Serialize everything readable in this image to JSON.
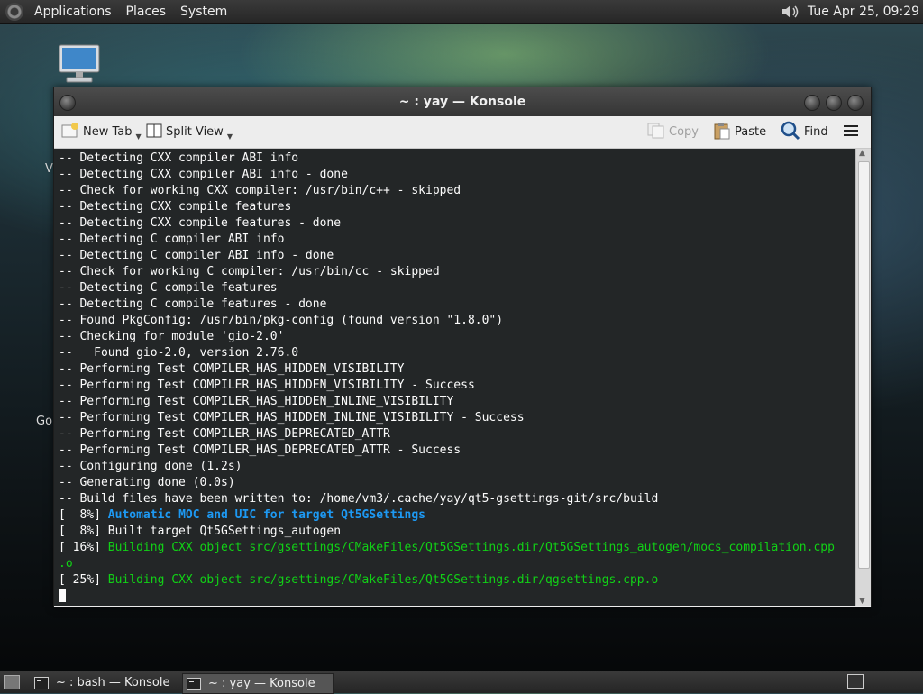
{
  "top_panel": {
    "menus": [
      "Applications",
      "Places",
      "System"
    ],
    "clock": "Tue Apr 25, 09:29"
  },
  "desktop": {
    "labels": [
      "Vi",
      "Go"
    ]
  },
  "window": {
    "title": "~ : yay — Konsole"
  },
  "toolbar": {
    "new_tab": "New Tab",
    "split_view": "Split View",
    "copy": "Copy",
    "paste": "Paste",
    "find": "Find"
  },
  "terminal": {
    "lines": [
      {
        "text": "-- Detecting CXX compiler ABI info"
      },
      {
        "text": "-- Detecting CXX compiler ABI info - done"
      },
      {
        "text": "-- Check for working CXX compiler: /usr/bin/c++ - skipped"
      },
      {
        "text": "-- Detecting CXX compile features"
      },
      {
        "text": "-- Detecting CXX compile features - done"
      },
      {
        "text": "-- Detecting C compiler ABI info"
      },
      {
        "text": "-- Detecting C compiler ABI info - done"
      },
      {
        "text": "-- Check for working C compiler: /usr/bin/cc - skipped"
      },
      {
        "text": "-- Detecting C compile features"
      },
      {
        "text": "-- Detecting C compile features - done"
      },
      {
        "text": "-- Found PkgConfig: /usr/bin/pkg-config (found version \"1.8.0\")"
      },
      {
        "text": "-- Checking for module 'gio-2.0'"
      },
      {
        "text": "--   Found gio-2.0, version 2.76.0"
      },
      {
        "text": "-- Performing Test COMPILER_HAS_HIDDEN_VISIBILITY"
      },
      {
        "text": "-- Performing Test COMPILER_HAS_HIDDEN_VISIBILITY - Success"
      },
      {
        "text": "-- Performing Test COMPILER_HAS_HIDDEN_INLINE_VISIBILITY"
      },
      {
        "text": "-- Performing Test COMPILER_HAS_HIDDEN_INLINE_VISIBILITY - Success"
      },
      {
        "text": "-- Performing Test COMPILER_HAS_DEPRECATED_ATTR"
      },
      {
        "text": "-- Performing Test COMPILER_HAS_DEPRECATED_ATTR - Success"
      },
      {
        "text": "-- Configuring done (1.2s)"
      },
      {
        "text": "-- Generating done (0.0s)"
      },
      {
        "text": "-- Build files have been written to: /home/vm3/.cache/yay/qt5-gsettings-git/src/build"
      },
      {
        "prefix": "[  8%] ",
        "text": "Automatic MOC and UIC for target Qt5GSettings",
        "style": "blue"
      },
      {
        "text": "[  8%] Built target Qt5GSettings_autogen"
      },
      {
        "prefix": "[ 16%] ",
        "text": "Building CXX object src/gsettings/CMakeFiles/Qt5GSettings.dir/Qt5GSettings_autogen/mocs_compilation.cpp",
        "style": "green"
      },
      {
        "text": ".o",
        "style": "green"
      },
      {
        "prefix": "[ 25%] ",
        "text": "Building CXX object src/gsettings/CMakeFiles/Qt5GSettings.dir/qgsettings.cpp.o",
        "style": "green"
      }
    ]
  },
  "taskbar": {
    "tasks": [
      "~ : bash — Konsole",
      "~ : yay — Konsole"
    ]
  },
  "colors": {
    "terminal_bg": "#232627",
    "terminal_fg": "#fcfcfc",
    "blue": "#1d99f3",
    "green": "#11d116"
  }
}
